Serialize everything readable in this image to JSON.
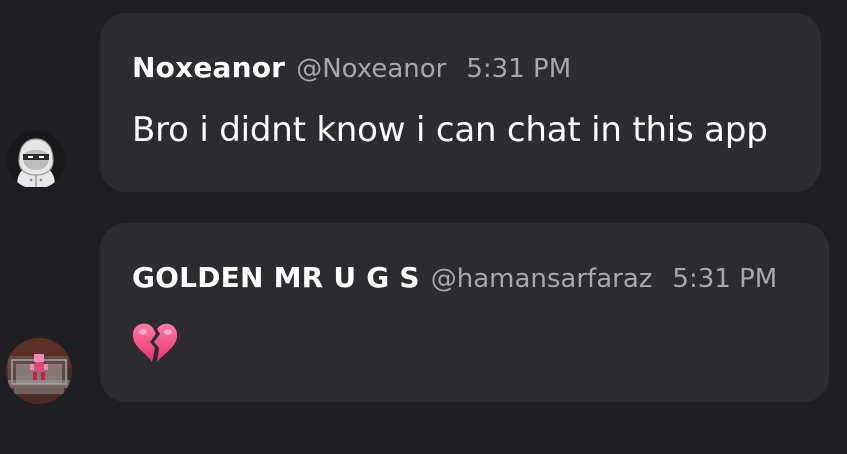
{
  "messages": [
    {
      "author_name": "Noxeanor",
      "author_handle": "@Noxeanor",
      "time": "5:31 PM",
      "text": "Bro i didnt know i can chat in this app",
      "avatar_icon": "hooded-ninja-avatar"
    },
    {
      "author_name": "GOLDEN MR U G S",
      "author_handle": "@hamansarfaraz",
      "time": "5:31 PM",
      "emoji": "broken-heart",
      "avatar_icon": "pixel-character-avatar"
    }
  ],
  "colors": {
    "background": "#1f1e22",
    "bubble": "#2c2b30",
    "name": "#ffffff",
    "meta": "#a8a7ad",
    "heart": "#f0568f"
  }
}
